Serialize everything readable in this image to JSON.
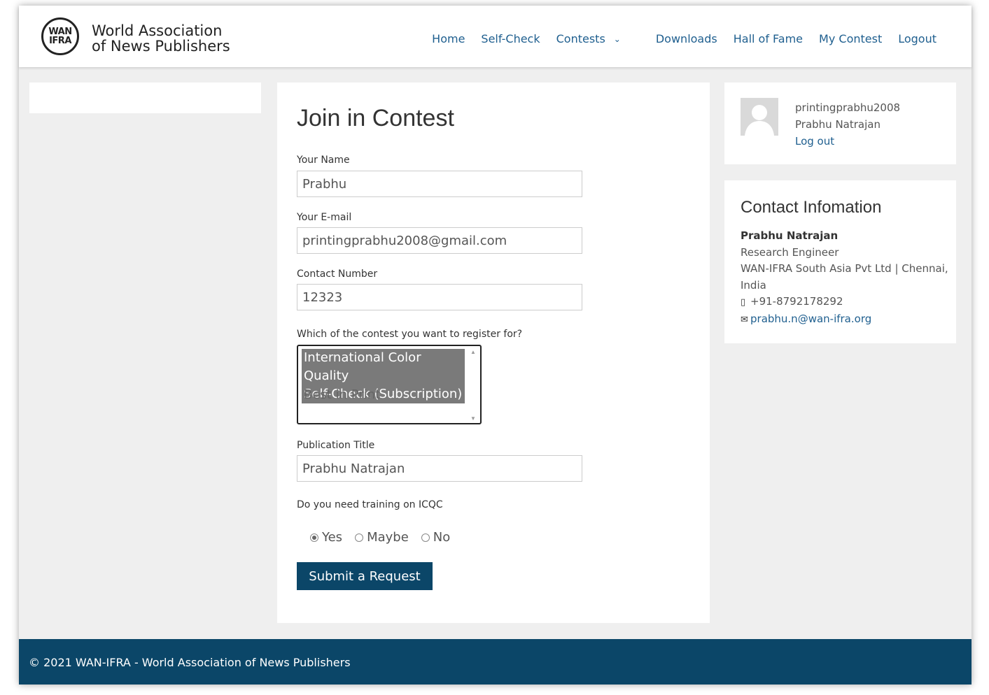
{
  "brand": {
    "mark_line1": "WAN",
    "mark_line2": "IFRA",
    "name_line1": "World Association",
    "name_line2": "of News Publishers"
  },
  "nav": {
    "home": "Home",
    "self_check": "Self-Check",
    "contests": "Contests",
    "downloads": "Downloads",
    "hall_of_fame": "Hall of Fame",
    "my_contest": "My Contest",
    "logout": "Logout"
  },
  "form": {
    "title": "Join in Contest",
    "name_label": "Your Name",
    "name_value": "Prabhu",
    "email_label": "Your E-mail",
    "email_value": "printingprabhu2008@gmail.com",
    "contact_label": "Contact Number",
    "contact_value": "12323",
    "contest_label": "Which of the contest you want to register for?",
    "contest_options": {
      "selected_line1": "International Color Quality",
      "selected_line2": "Self-Check (Subscription)",
      "other": "Best in Print"
    },
    "publication_label": "Publication Title",
    "publication_value": "Prabhu Natrajan",
    "training_label": "Do you need training on ICQC",
    "training_options": {
      "yes": "Yes",
      "maybe": "Maybe",
      "no": "No"
    },
    "training_selected": "Yes",
    "submit_label": "Submit a Request"
  },
  "user": {
    "username": "printingprabhu2008",
    "full_name": "Prabhu Natrajan",
    "logout_link": "Log out"
  },
  "contact": {
    "title": "Contact Infomation",
    "name": "Prabhu Natrajan",
    "role": "Research Engineer",
    "company": "WAN-IFRA South Asia Pvt Ltd | Chennai, India",
    "phone": "+91-8792178292",
    "email": "prabhu.n@wan-ifra.org"
  },
  "footer": {
    "copyright": "© 2021 WAN-IFRA - World Association of News Publishers"
  },
  "colors": {
    "primary": "#0b4668",
    "link": "#1f5f8f",
    "page_bg": "#efefef"
  }
}
